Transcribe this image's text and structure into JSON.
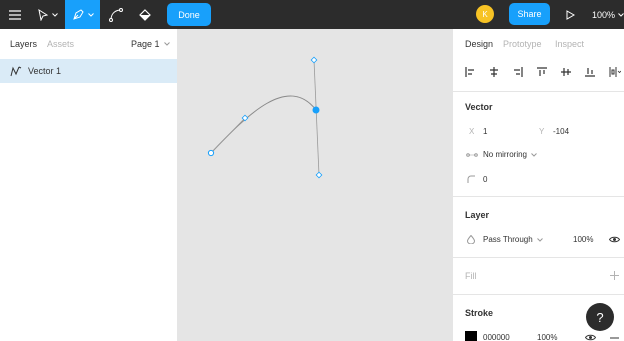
{
  "toolbar": {
    "done_label": "Done",
    "avatar_initial": "K",
    "share_label": "Share",
    "zoom_label": "100%"
  },
  "left_panel": {
    "tabs": [
      "Layers",
      "Assets"
    ],
    "page_selector": "Page 1",
    "layers": [
      {
        "name": "Vector 1",
        "selected": true
      }
    ]
  },
  "right_panel": {
    "tabs": [
      "Design",
      "Prototype",
      "Inspect"
    ],
    "vector": {
      "title": "Vector",
      "x_label": "X",
      "x_value": "1",
      "y_label": "Y",
      "y_value": "-104",
      "mirroring": "No mirroring",
      "corner_radius": "0"
    },
    "layer": {
      "title": "Layer",
      "blend_mode": "Pass Through",
      "opacity": "100%"
    },
    "fill": {
      "title": "Fill"
    },
    "stroke": {
      "title": "Stroke",
      "color_hex": "000000",
      "opacity": "100%"
    }
  },
  "help_label": "?",
  "colors": {
    "toolbar_bg": "#2c2c2c",
    "accent": "#18a0fb",
    "avatar": "#f7c325",
    "layer_selected_bg": "#daebf7",
    "canvas_bg": "#e5e5e5"
  }
}
